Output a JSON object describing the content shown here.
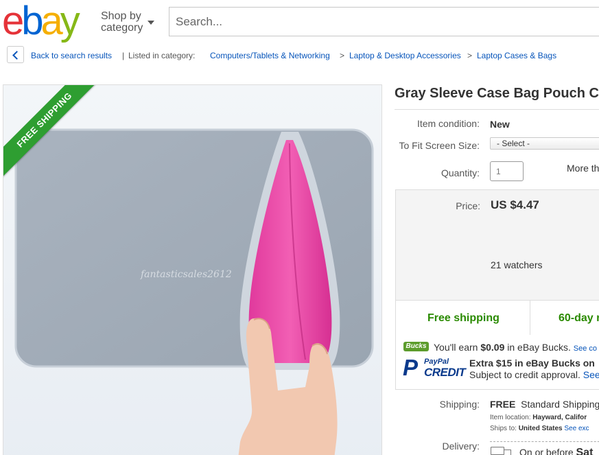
{
  "header": {
    "logo_letters": [
      "e",
      "b",
      "a",
      "y"
    ],
    "shop_by_line1": "Shop by",
    "shop_by_line2": "category",
    "search_placeholder": "Search..."
  },
  "breadcrumb": {
    "back_label": "Back to search results",
    "separator": "|",
    "listed_in": "Listed in category:",
    "categories": [
      "Computers/Tablets & Networking",
      "Laptop & Desktop Accessories",
      "Laptop Cases & Bags"
    ],
    "arrow": ">"
  },
  "image": {
    "ribbon_text": "FREE SHIPPING",
    "watermark": "fantasticsales2612"
  },
  "listing": {
    "title": "Gray Sleeve Case Bag Pouch Co",
    "condition_label": "Item condition:",
    "condition_value": "New",
    "fit_label": "To Fit Screen Size:",
    "fit_value": "- Select -",
    "quantity_label": "Quantity:",
    "quantity_value": "1",
    "more_than": "More th",
    "price_label": "Price:",
    "price_value": "US $4.47",
    "watchers": "21 watchers",
    "free_shipping": "Free shipping",
    "returns": "60-day r"
  },
  "promo": {
    "bucks_badge": "Bucks",
    "bucks_prefix": "You'll earn ",
    "bucks_amount": "$0.09",
    "bucks_suffix": " in eBay Bucks.",
    "bucks_link": "See co",
    "paypal_p": "P",
    "paypal_word": "PayPal",
    "credit_word": "CREDIT",
    "credit_line1": "Extra $15 in eBay Bucks on",
    "credit_line2": "Subject to credit approval.",
    "credit_link": "See"
  },
  "shipping": {
    "label": "Shipping:",
    "free": "FREE",
    "standard": "Standard Shipping",
    "location_label": "Item location:",
    "location_value": "Hayward, Califor",
    "ships_to_label": "Ships to:",
    "ships_to_value": "United States",
    "ships_to_link": "See exc",
    "delivery_label": "Delivery:",
    "delivery_prefix": "On or before",
    "delivery_day": "Sat"
  },
  "colors": {
    "ebay_red": "#e53238",
    "ebay_blue": "#0064d2",
    "ebay_yellow": "#f5af02",
    "ebay_green": "#86b817",
    "link": "#0654ba",
    "free_green": "#2a8a00",
    "ribbon_green": "#2e9e31"
  }
}
